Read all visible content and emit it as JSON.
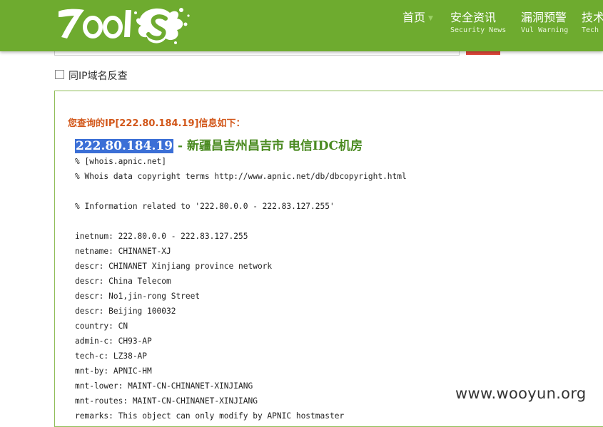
{
  "header": {
    "logo_text": "7ools",
    "nav": [
      {
        "label": "首页",
        "sub": ""
      },
      {
        "label": "安全资讯",
        "sub": "Security News"
      },
      {
        "label": "漏洞预警",
        "sub": "Vul Warning"
      },
      {
        "label": "技术",
        "sub": "Tech"
      }
    ]
  },
  "search": {
    "reverse_checkbox_label": "同IP域名反查",
    "reverse_checked": false
  },
  "result": {
    "heading": "您查询的IP[222.80.184.19]信息如下：",
    "ip": "222.80.184.19",
    "location": " - 新疆昌吉州昌吉市 电信IDC机房",
    "whois_lines": [
      "% [whois.apnic.net]",
      "% Whois data copyright terms http://www.apnic.net/db/dbcopyright.html",
      "",
      "% Information related to '222.80.0.0 - 222.83.127.255'",
      "",
      "inetnum: 222.80.0.0 - 222.83.127.255",
      "netname: CHINANET-XJ",
      "descr: CHINANET Xinjiang province network",
      "descr: China Telecom",
      "descr: No1,jin-rong Street",
      "descr: Beijing 100032",
      "country: CN",
      "admin-c: CH93-AP",
      "tech-c: LZ38-AP",
      "mnt-by: APNIC-HM",
      "mnt-lower: MAINT-CN-CHINANET-XINJIANG",
      "mnt-routes: MAINT-CN-CHINANET-XINJIANG",
      "remarks: This object can only modify by APNIC hostmaster"
    ]
  },
  "watermark": "www.wooyun.org",
  "colors": {
    "header_green": "#6eab2f",
    "heading_orange": "#d2571a",
    "ip_green": "#4a8a20",
    "selection_blue": "#3b6fd6",
    "search_red": "#e0473b"
  }
}
